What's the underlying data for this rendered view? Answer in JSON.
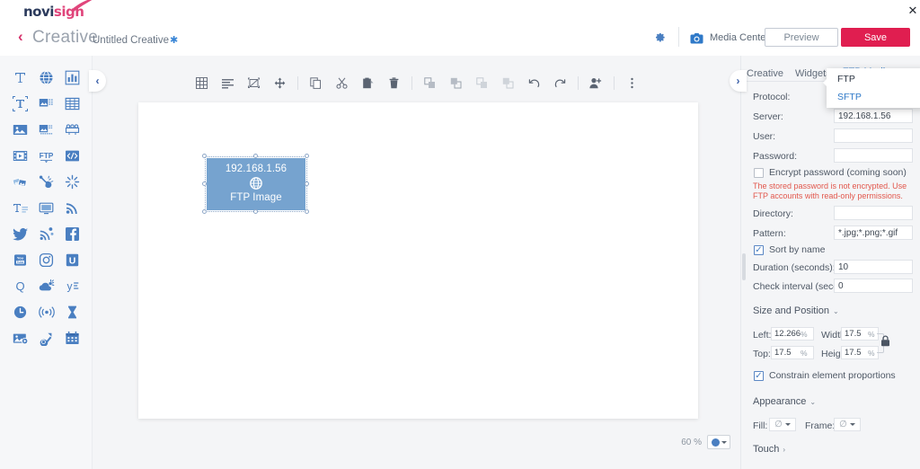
{
  "header": {
    "logo_novi": "novi",
    "logo_sign": "sign",
    "back_label": "‹",
    "product": "Creative",
    "doc_title": "Untitled Creative",
    "doc_modified_mark": "✱",
    "gear_icon": "gear-icon",
    "media_center_label": "Media Center",
    "media_center_icon": "camera-icon",
    "preview_label": "Preview",
    "save_label": "Save",
    "close_label": "✕",
    "accent_red": "#e01e50",
    "accent_blue": "#2f79c8"
  },
  "rail": {
    "items": [
      {
        "name": "text-widget",
        "icon": "text-icon"
      },
      {
        "name": "web-widget",
        "icon": "globe-icon"
      },
      {
        "name": "chart-widget",
        "icon": "bar-chart-icon"
      },
      {
        "name": "scrolling-text-widget",
        "icon": "scroll-text-icon"
      },
      {
        "name": "image-slideshow-widget",
        "icon": "image-transition-icon"
      },
      {
        "name": "table-widget",
        "icon": "table-icon"
      },
      {
        "name": "image-widget",
        "icon": "picture-icon"
      },
      {
        "name": "animated-image-widget",
        "icon": "animated-picture-icon"
      },
      {
        "name": "playlist-widget",
        "icon": "playlist-icon"
      },
      {
        "name": "video-widget",
        "icon": "film-icon"
      },
      {
        "name": "ftp-widget",
        "icon": "ftp-icon",
        "label": "FTP",
        "selected": true
      },
      {
        "name": "html-widget",
        "icon": "code-icon"
      },
      {
        "name": "gallery-widget",
        "icon": "photos-icon"
      },
      {
        "name": "touch-widget",
        "icon": "touch-pointer-icon"
      },
      {
        "name": "effects-widget",
        "icon": "sparkle-icon"
      },
      {
        "name": "ticker-widget",
        "icon": "ticker-text-icon"
      },
      {
        "name": "screen-widget",
        "icon": "monitor-icon"
      },
      {
        "name": "rss-widget",
        "icon": "rss-icon"
      },
      {
        "name": "twitter-widget",
        "icon": "twitter-icon"
      },
      {
        "name": "social-feed-widget",
        "icon": "social-share-icon"
      },
      {
        "name": "facebook-widget",
        "icon": "facebook-icon"
      },
      {
        "name": "youtube-widget",
        "icon": "youtube-icon"
      },
      {
        "name": "instagram-widget",
        "icon": "instagram-icon"
      },
      {
        "name": "upsocial-widget",
        "icon": "letter-u-icon"
      },
      {
        "name": "quora-widget",
        "icon": "letter-q-icon"
      },
      {
        "name": "weather-widget",
        "icon": "weather-cloud-sun-icon"
      },
      {
        "name": "yammer-widget",
        "icon": "yammer-icon"
      },
      {
        "name": "clock-widget",
        "icon": "clock-icon"
      },
      {
        "name": "live-stream-widget",
        "icon": "broadcast-icon"
      },
      {
        "name": "countdown-widget",
        "icon": "hourglass-icon"
      },
      {
        "name": "media-widget",
        "icon": "media-image-icon"
      },
      {
        "name": "qr-widget",
        "icon": "qr-shape-icon"
      },
      {
        "name": "calendar-widget",
        "icon": "calendar-icon"
      }
    ]
  },
  "canvas": {
    "collapse_left_icon": "chevron-left-icon",
    "collapse_right_icon": "chevron-right-icon",
    "toolbar": [
      {
        "name": "grid-toggle-button",
        "icon": "grid-icon"
      },
      {
        "name": "align-button",
        "icon": "align-left-icon"
      },
      {
        "name": "fit-button",
        "icon": "fit-frame-icon"
      },
      {
        "name": "move-button",
        "icon": "move-arrows-icon"
      },
      {
        "name": "copy-button",
        "icon": "copy-icon"
      },
      {
        "name": "cut-button",
        "icon": "scissors-icon"
      },
      {
        "name": "paste-button",
        "icon": "paste-icon"
      },
      {
        "name": "delete-button",
        "icon": "trash-icon"
      },
      {
        "name": "bring-forward-button",
        "icon": "layer-forward-icon"
      },
      {
        "name": "send-backward-button",
        "icon": "layer-backward-icon"
      },
      {
        "name": "bring-front-button",
        "icon": "layer-front-icon"
      },
      {
        "name": "send-back-button",
        "icon": "layer-back-icon"
      },
      {
        "name": "undo-button",
        "icon": "undo-icon"
      },
      {
        "name": "redo-button",
        "icon": "redo-icon"
      },
      {
        "name": "share-user-button",
        "icon": "add-user-icon"
      },
      {
        "name": "more-button",
        "icon": "kebab-menu-icon"
      }
    ],
    "element": {
      "ip": "192.168.1.56",
      "type_label": "FTP Image",
      "icon": "globe-icon",
      "fill_color": "#76a3cf"
    },
    "zoom_value": "60",
    "zoom_unit": "%"
  },
  "panel": {
    "tabs": [
      {
        "label": "Creative",
        "active": false,
        "name": "tab-creative"
      },
      {
        "label": "Widgets",
        "active": false,
        "name": "tab-widgets"
      },
      {
        "label": "FTP Media",
        "active": true,
        "name": "tab-ftp-media"
      }
    ],
    "fields": {
      "protocol_label": "Protocol:",
      "protocol_value": "SFTP",
      "server_label": "Server:",
      "server_value": "192.168.1.56",
      "user_label": "User:",
      "user_value": "",
      "password_label": "Password:",
      "password_value": "",
      "encrypt_label": "Encrypt password (coming soon)",
      "encrypt_checked": false,
      "warning": "The stored password is not encrypted. Use FTP accounts with read-only permissions.",
      "directory_label": "Directory:",
      "directory_value": "",
      "pattern_label": "Pattern:",
      "pattern_value": "*.jpg;*.png;*.gif",
      "sort_label": "Sort by name",
      "sort_checked": true,
      "duration_label": "Duration (seconds):",
      "duration_value": "10",
      "interval_label": "Check interval (seconds):",
      "interval_value": "0"
    },
    "size_position": {
      "title": "Size and Position",
      "chevron": "⌄",
      "left_label": "Left:",
      "left_value": "12.266",
      "left_unit": "%",
      "top_label": "Top:",
      "top_value": "17.5",
      "top_unit": "%",
      "width_label": "Width:",
      "width_value": "17.5",
      "width_unit": "%",
      "height_label": "Height:",
      "height_value": "17.5",
      "height_unit": "%",
      "lock_icon": "lock-icon",
      "constrain_label": "Constrain element proportions",
      "constrain_checked": true
    },
    "appearance": {
      "title": "Appearance",
      "chevron": "⌄",
      "fill_label": "Fill:",
      "fill_value": "∅",
      "frame_label": "Frame:",
      "frame_value": "∅"
    },
    "touch": {
      "title": "Touch",
      "chevron": "›"
    },
    "dropdown": {
      "items": [
        {
          "label": "FTP",
          "state": "selected"
        },
        {
          "label": "SFTP",
          "state": "link"
        }
      ]
    }
  }
}
